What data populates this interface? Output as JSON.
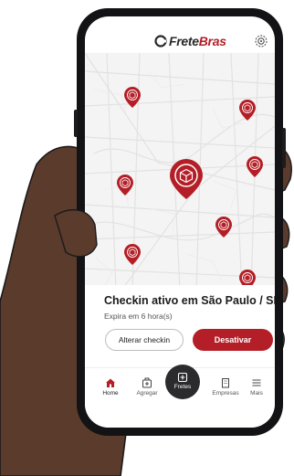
{
  "app": {
    "logo_part1": "Frete",
    "logo_part2": "Bras",
    "settings_icon": "settings-icon"
  },
  "map": {
    "pin_icon": "cargo-box-pin-icon",
    "pin_color": "#b41e26"
  },
  "checkin": {
    "title": "Checkin ativo em São Paulo / SP",
    "subtitle": "Expira em 6 hora(s)",
    "alter_label": "Alterar checkin",
    "deactivate_label": "Desativar"
  },
  "nav": {
    "items": [
      {
        "label": "Home",
        "icon": "home-icon"
      },
      {
        "label": "Agregar",
        "icon": "box-add-icon"
      },
      {
        "label": "Fretes",
        "icon": "freight-icon"
      },
      {
        "label": "Empresas",
        "icon": "building-icon"
      },
      {
        "label": "Mais",
        "icon": "menu-icon"
      }
    ]
  },
  "colors": {
    "brand": "#b41e26",
    "phone_frame": "#131316",
    "skin": "#5a3b2c"
  }
}
